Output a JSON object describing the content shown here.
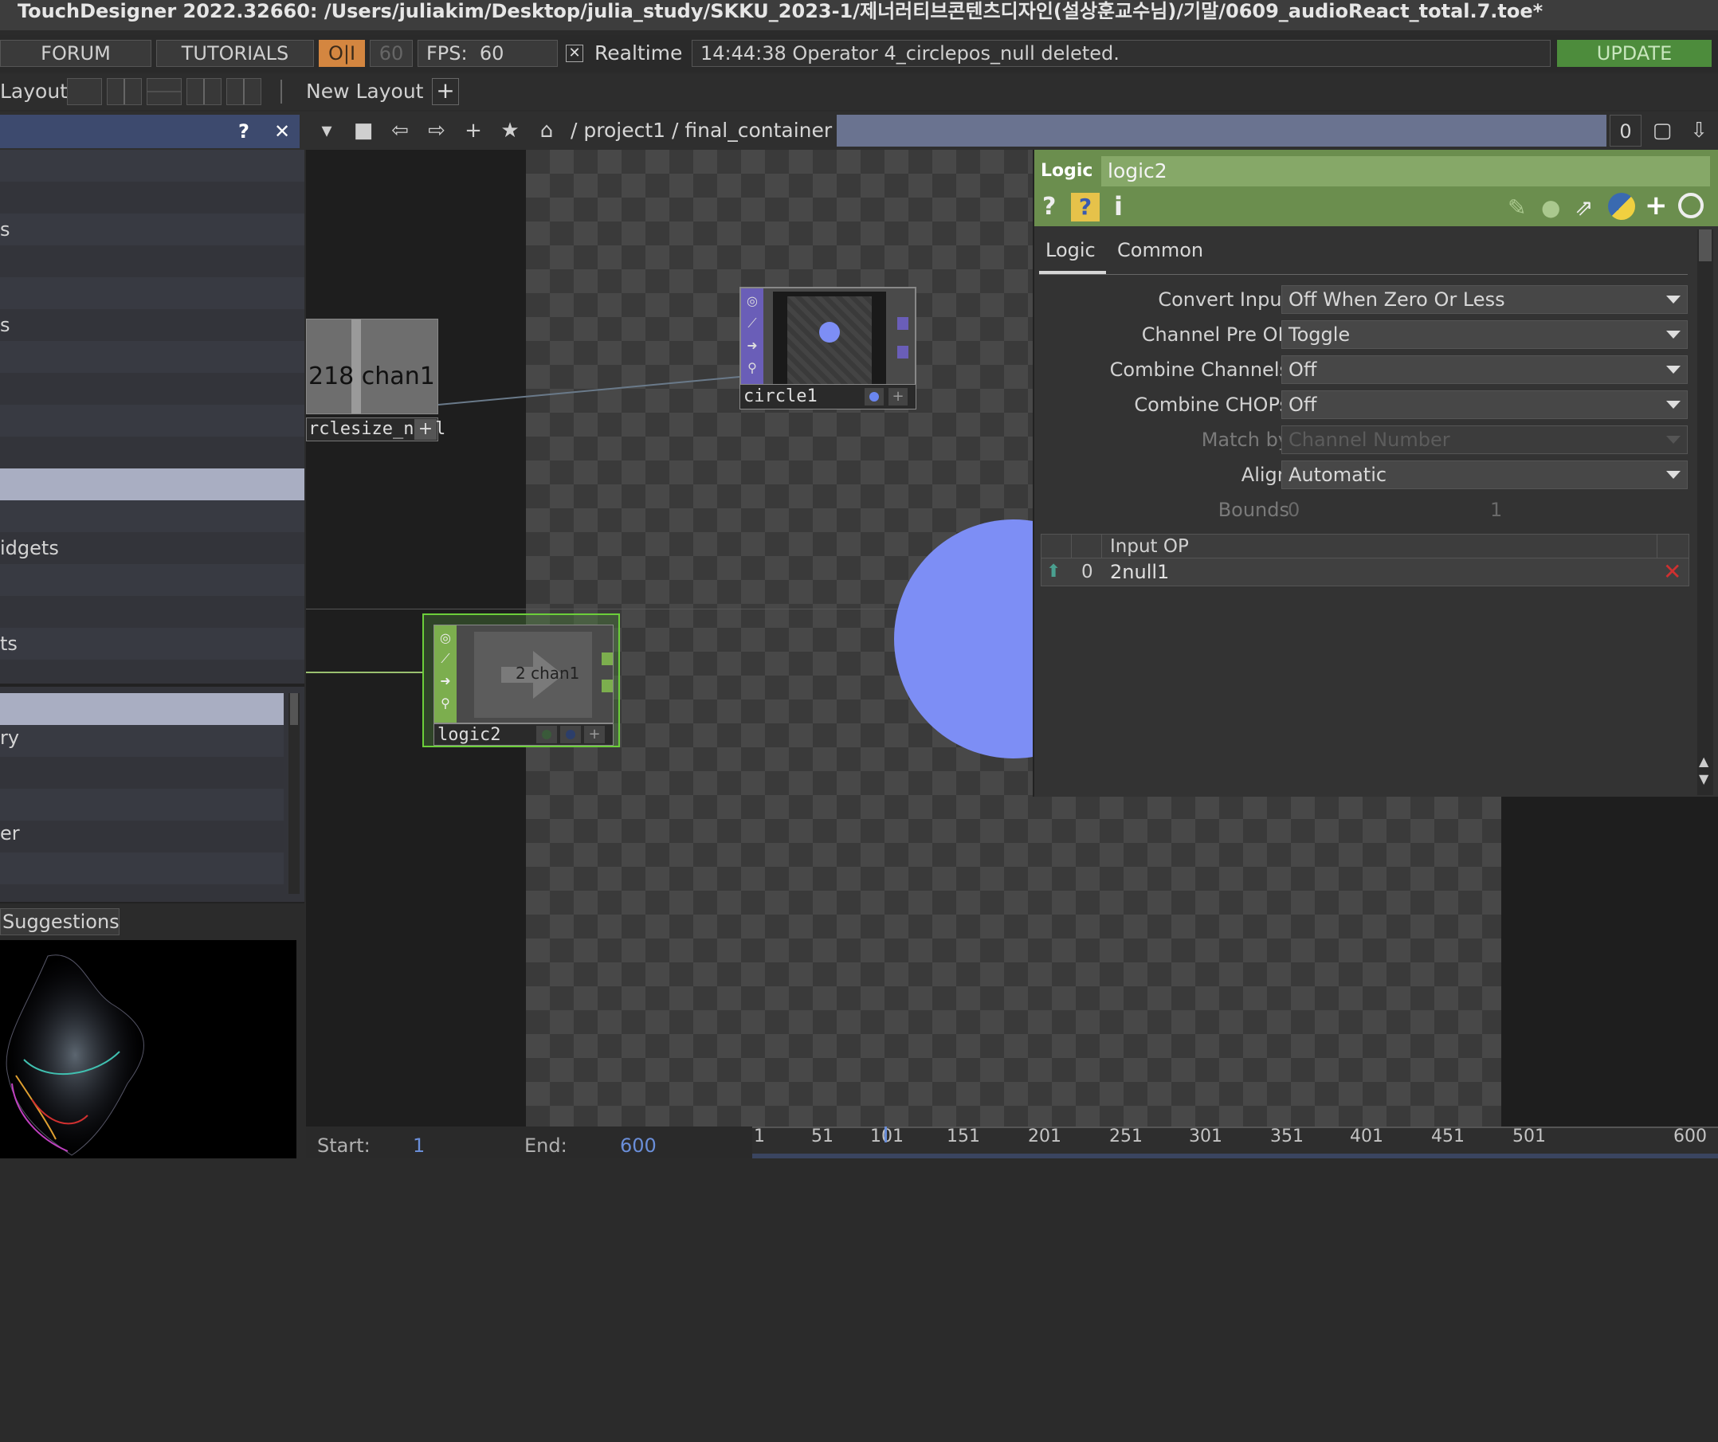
{
  "window": {
    "title": "TouchDesigner 2022.32660: /Users/juliakim/Desktop/julia_study/SKKU_2023-1/제너러티브콘텐츠디자인(설상훈교수님)/기말/0609_audioReact_total.7.toe*"
  },
  "toolbar": {
    "forum": "FORUM",
    "tutorials": "TUTORIALS",
    "oi": "O|I",
    "fps_target": "60",
    "fps_label": "FPS:",
    "fps_value": "60",
    "realtime_check": "✕",
    "realtime_label": "Realtime",
    "status_message": "14:44:38 Operator 4_circlepos_null deleted.",
    "update": "UPDATE"
  },
  "layout_bar": {
    "layout_label": "Layout",
    "new_layout": "New Layout",
    "add": "+"
  },
  "left_panel": {
    "help": "?",
    "close": "✕",
    "items": [
      "s",
      "s",
      "idgets",
      "ts"
    ],
    "list2": [
      "ry",
      "er"
    ],
    "suggestions": "Suggestions"
  },
  "path_bar": {
    "path": "/ project1 / final_container",
    "counter": "0"
  },
  "nodes": {
    "chan1_value": "218 chan1",
    "chan1_name": "rclesize_null",
    "circle_name": "circle1",
    "logic_name": "logic2",
    "logic_inner": "2 chan1"
  },
  "params": {
    "op_type": "Logic",
    "op_name": "logic2",
    "tabs": [
      "Logic",
      "Common"
    ],
    "rows": [
      {
        "label": "Convert Input",
        "value": "Off When Zero Or Less"
      },
      {
        "label": "Channel Pre OP",
        "value": "Toggle"
      },
      {
        "label": "Combine Channels",
        "value": "Off"
      },
      {
        "label": "Combine CHOPs",
        "value": "Off"
      },
      {
        "label": "Match by",
        "value": "Channel Number"
      },
      {
        "label": "Align",
        "value": "Automatic"
      }
    ],
    "bounds_label": "Bounds",
    "bounds_min": "0",
    "bounds_max": "1",
    "input_header": "Input OP",
    "input_index": "0",
    "input_value": "2null1"
  },
  "timeline": {
    "start_label": "Start:",
    "start_value": "1",
    "end_label": "End:",
    "end_value": "600",
    "ticks": [
      "1",
      "51",
      "101",
      "151",
      "201",
      "251",
      "301",
      "351",
      "401",
      "451",
      "501",
      "600"
    ]
  },
  "colors": {
    "accent_green": "#6b8e4e",
    "update_green": "#4a8a3a",
    "circle_blue": "#7d8ef5",
    "oi_orange": "#e08a3c"
  }
}
